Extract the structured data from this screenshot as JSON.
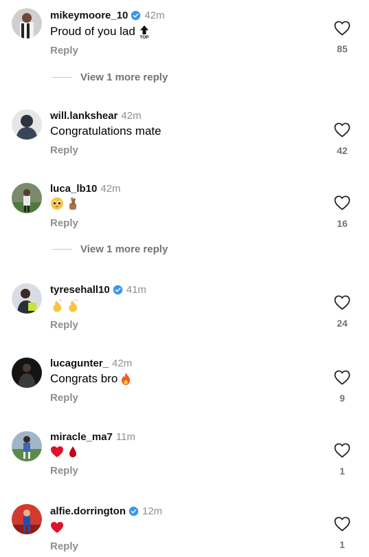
{
  "colors": {
    "verified": "#3897f0",
    "secondary_text": "#8e8e8e",
    "heart_stroke": "#262626",
    "red_heart": "#e0112b",
    "clap": "#f7c542"
  },
  "comments": [
    {
      "username": "mikeymoore_10",
      "verified": true,
      "time": "42m",
      "text": "Proud of you lad",
      "emojis": [
        "top-arrow-icon"
      ],
      "reply_label": "Reply",
      "likes": "85",
      "more_replies": "View 1 more reply"
    },
    {
      "username": "will.lankshear",
      "verified": false,
      "time": "42m",
      "text": "Congratulations mate",
      "emojis": [],
      "reply_label": "Reply",
      "likes": "42"
    },
    {
      "username": "luca_lb10",
      "verified": false,
      "time": "42m",
      "text": "",
      "emojis": [
        "pleading-face-emoji",
        "crossed-fingers-emoji"
      ],
      "reply_label": "Reply",
      "likes": "16",
      "more_replies": "View 1 more reply"
    },
    {
      "username": "tyresehall10",
      "verified": true,
      "time": "41m",
      "text": "",
      "emojis": [
        "clapping-hands-emoji",
        "clapping-hands-emoji"
      ],
      "reply_label": "Reply",
      "likes": "24"
    },
    {
      "username": "lucagunter_",
      "verified": false,
      "time": "42m",
      "text": "Congrats bro",
      "emojis": [
        "fire-emoji"
      ],
      "reply_label": "Reply",
      "likes": "9"
    },
    {
      "username": "miracle_ma7",
      "verified": false,
      "time": "11m",
      "text": "",
      "emojis": [
        "red-heart-emoji",
        "drop-of-blood-emoji"
      ],
      "reply_label": "Reply",
      "likes": "1"
    },
    {
      "username": "alfie.dorrington",
      "verified": true,
      "time": "12m",
      "text": "",
      "emojis": [
        "red-heart-emoji"
      ],
      "reply_label": "Reply",
      "likes": "1"
    }
  ]
}
